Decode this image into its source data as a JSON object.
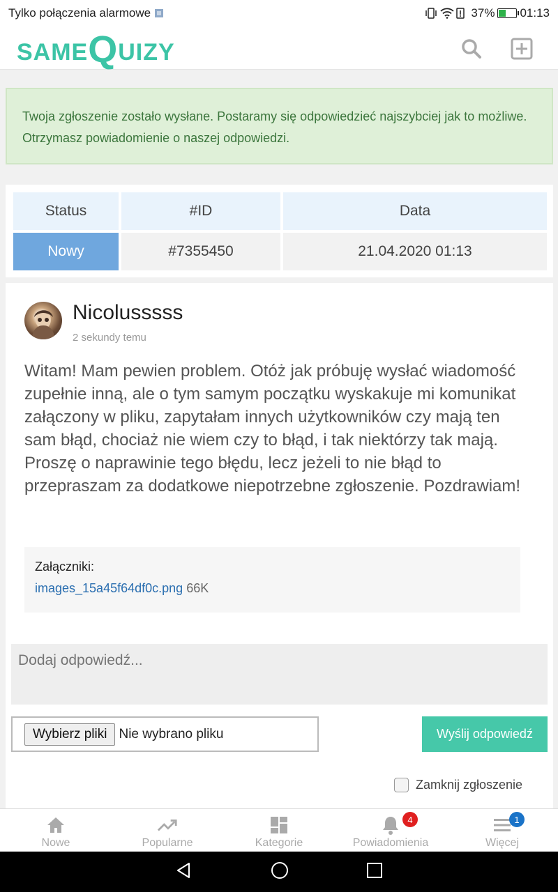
{
  "status_bar": {
    "carrier_text": "Tylko połączenia alarmowe",
    "battery_percent": "37%",
    "time": "01:13"
  },
  "header": {
    "logo_same": "SAME",
    "logo_q": "Q",
    "logo_uizy": "UIZY",
    "brand_color": "#3cc4a6",
    "icons": [
      "search-icon",
      "add-icon"
    ]
  },
  "alert": {
    "text": "Twoja zgłoszenie zostało wysłane. Postaramy się odpowiedzieć najszybciej jak to możliwe. Otrzymasz powiadomienie o naszej odpowiedzi."
  },
  "ticket_table": {
    "headers": [
      "Status",
      "#ID",
      "Data"
    ],
    "row": [
      "Nowy",
      "#7355450",
      "21.04.2020 01:13"
    ]
  },
  "post": {
    "author": "Nicolusssss",
    "time_ago": "2 sekundy temu",
    "body": "Witam! Mam pewien problem. Otóż jak próbuję wysłać wiadomość zupełnie inną, ale o tym samym początku wyskakuje mi komunikat załączony w pliku, zapytałam innych użytkowników czy mają ten sam błąd, chociaż nie wiem czy to błąd, i tak niektórzy tak mają. Proszę o naprawinie tego błędu, lecz jeżeli to nie błąd to przepraszam za dodatkowe niepotrzebne zgłoszenie. Pozdrawiam!",
    "attachments_label": "Załączniki:",
    "attachment_name": "images_15a45f64df0c.png",
    "attachment_size": "66K"
  },
  "reply_form": {
    "placeholder": "Dodaj odpowiedź...",
    "file_button": "Wybierz pliki",
    "file_status": "Nie wybrano pliku",
    "send_label": "Wyślij odpowiedź",
    "close_label": "Zamknij zgłoszenie",
    "close_checked": false
  },
  "tabbar": {
    "items": [
      {
        "label": "Nowe",
        "icon": "home-icon"
      },
      {
        "label": "Popularne",
        "icon": "trending-icon"
      },
      {
        "label": "Kategorie",
        "icon": "categories-icon"
      },
      {
        "label": "Powiadomienia",
        "icon": "bell-icon",
        "badge": "4",
        "badge_color": "#e02020"
      },
      {
        "label": "Więcej",
        "icon": "menu-icon",
        "badge": "1",
        "badge_color": "#1a73c8"
      }
    ]
  },
  "android_nav": [
    "back-icon",
    "home-circle-icon",
    "recents-icon"
  ]
}
